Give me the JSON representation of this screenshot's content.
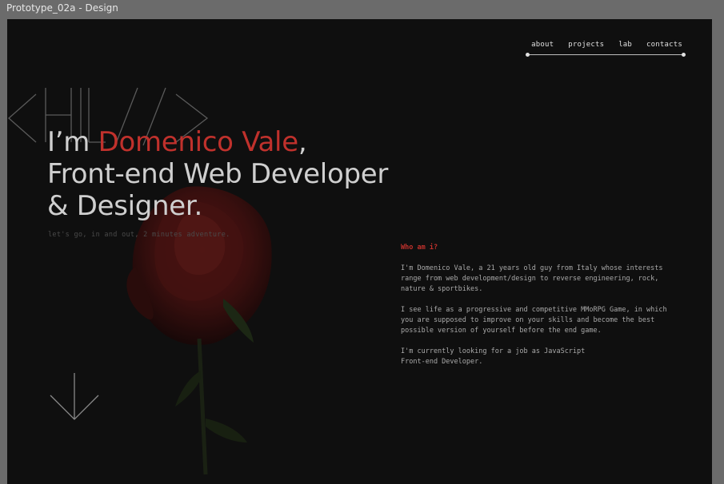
{
  "window": {
    "title": "Prototype_02a - Design"
  },
  "nav": {
    "items": [
      "about",
      "projects",
      "lab",
      "contacts"
    ]
  },
  "hero": {
    "line1_prefix": "I’m ",
    "line1_name": "Domenico Vale",
    "line1_suffix": ",",
    "line2": "Front-end Web Developer",
    "line3": "& Designer.",
    "tagline": "let's go, in and out, 2 minutes adventure."
  },
  "about": {
    "heading": "Who am i?",
    "paragraph1": "I'm Domenico Vale, a 21 years old guy from Italy whose interests range from web development/design to reverse engineering, rock, nature & sportbikes.",
    "paragraph2": "I see life as a progressive and competitive MMoRPG Game, in which you are supposed to improve on your skills and become the best possible version of yourself before the end game.",
    "paragraph3_line1": "I'm currently looking for a job as JavaScript",
    "paragraph3_line2": "Front-end Developer."
  },
  "icons": {
    "code": "code-brackets-icon",
    "arrow": "arrow-down-icon",
    "rose": "rose-image"
  },
  "colors": {
    "accent": "#c0312c",
    "background": "#0f0f0f",
    "text": "#cfcfcf"
  }
}
